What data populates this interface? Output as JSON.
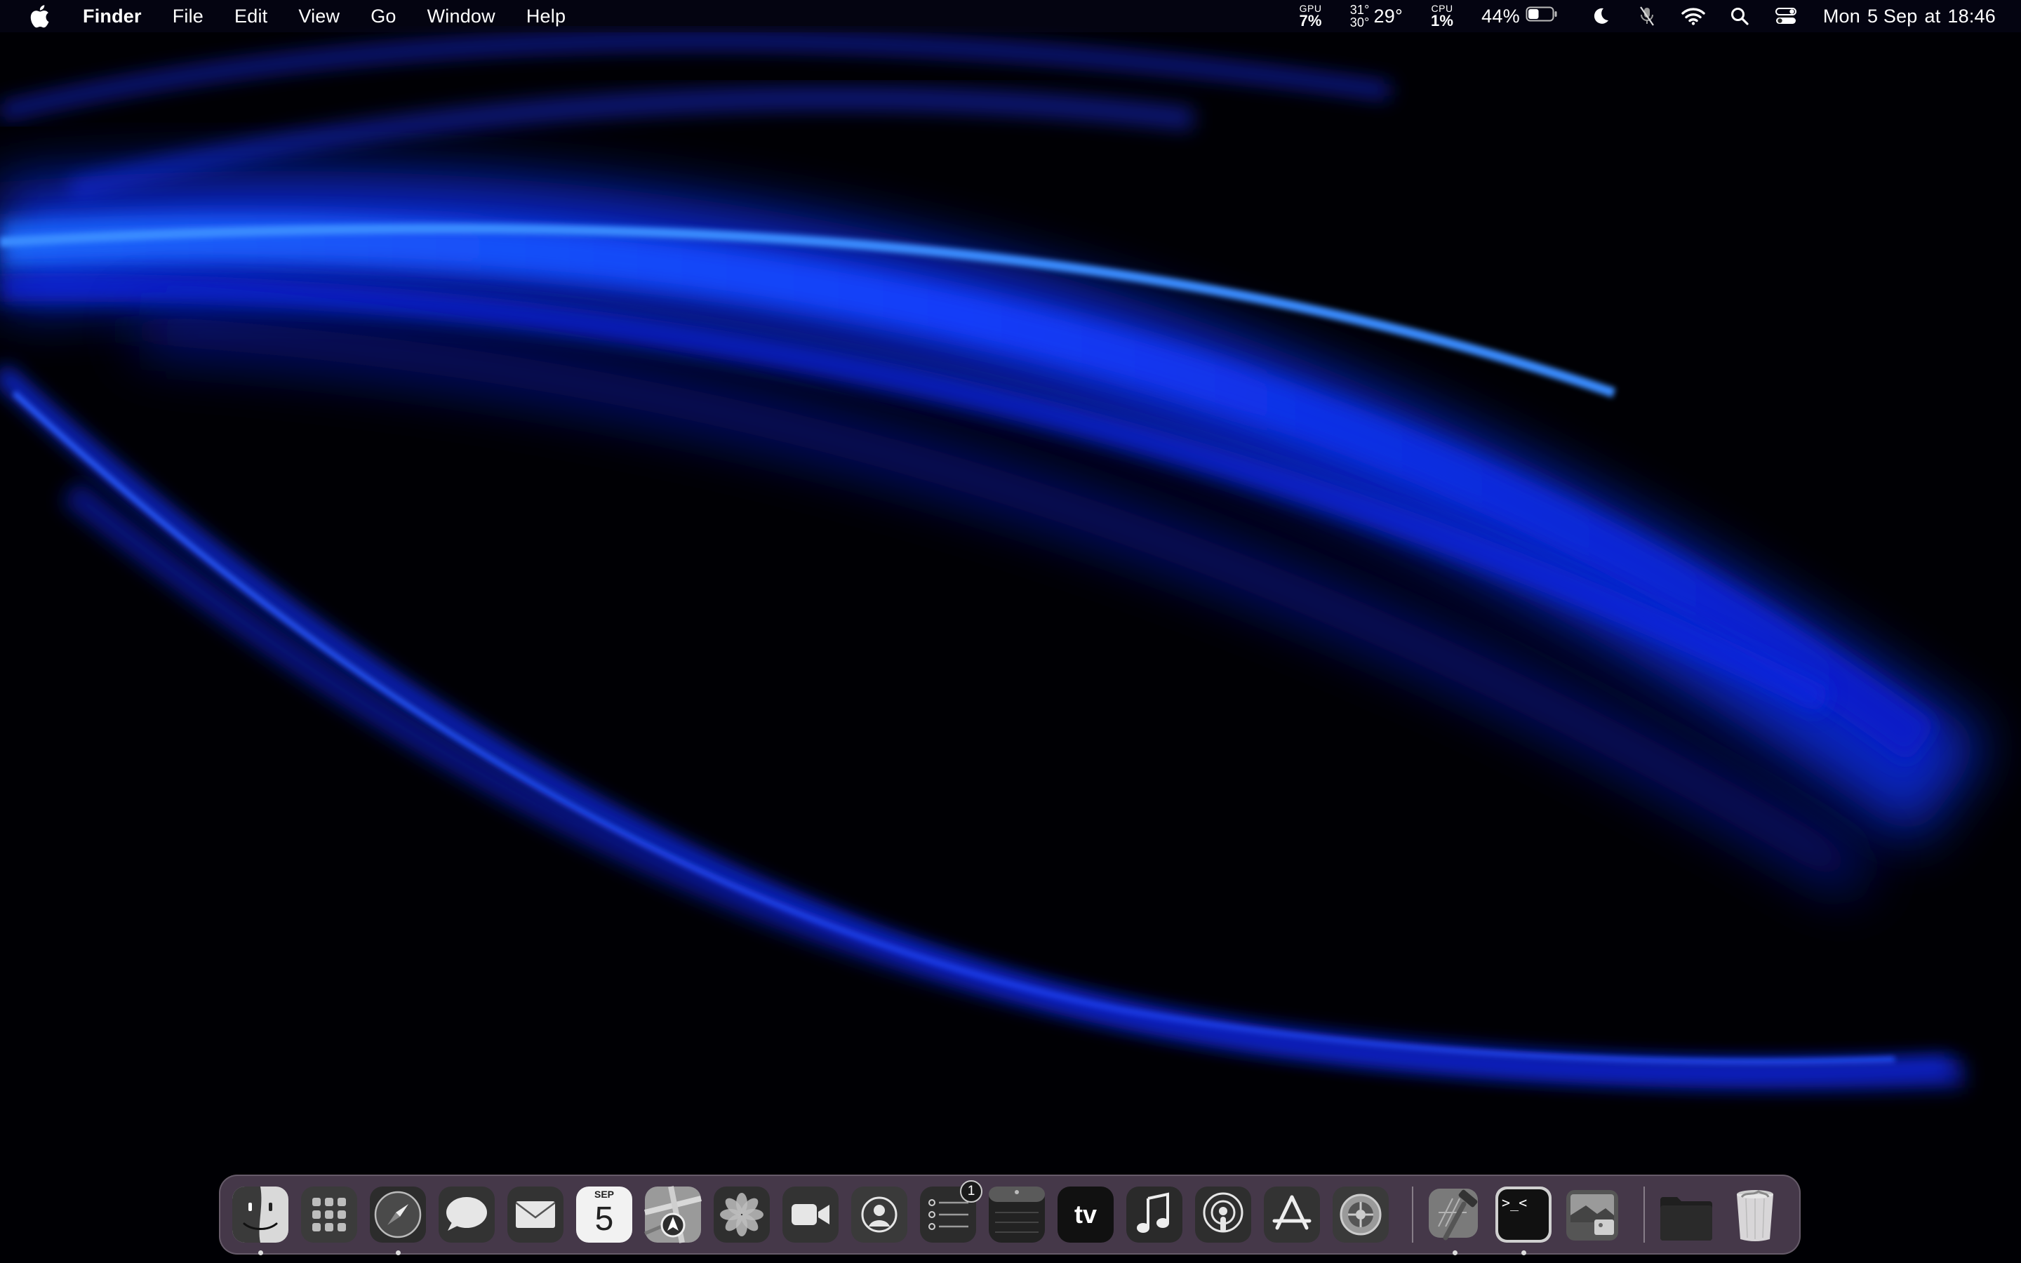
{
  "menubar": {
    "app_name": "Finder",
    "menus": [
      "File",
      "Edit",
      "View",
      "Go",
      "Window",
      "Help"
    ],
    "gpu": {
      "label": "GPU",
      "value": "7%"
    },
    "temperature": {
      "high": "31°",
      "low": "30°",
      "current": "29°"
    },
    "cpu": {
      "label": "CPU",
      "value": "1%"
    },
    "battery": {
      "percent_text": "44%",
      "level": 0.44
    },
    "clock": {
      "day": "Mon",
      "date": "5 Sep",
      "at": "at",
      "time": "18:46"
    },
    "status_icons": [
      "moon-icon",
      "muted-mic-icon",
      "wifi-icon",
      "search-icon",
      "control-center-icon"
    ]
  },
  "dock": {
    "calendar": {
      "month": "SEP",
      "day": "5"
    },
    "tv": {
      "label": "tv"
    },
    "reminders_badge": "1",
    "terminal_prompt": ">_<",
    "items": [
      "Finder",
      "Launchpad",
      "Safari",
      "Messages",
      "Mail",
      "Calendar",
      "Maps",
      "Photos",
      "FaceTime",
      "Contacts",
      "Reminders",
      "Notes",
      "TV",
      "Music",
      "Podcasts",
      "App Store",
      "System Settings",
      "Xcode",
      "Terminal",
      "Preview",
      "Folder",
      "Trash"
    ]
  },
  "colors": {
    "wallpaper_accent": "#1a3cff",
    "wallpaper_bright": "#2a7bff",
    "dock_bg": "#5f4e64"
  }
}
